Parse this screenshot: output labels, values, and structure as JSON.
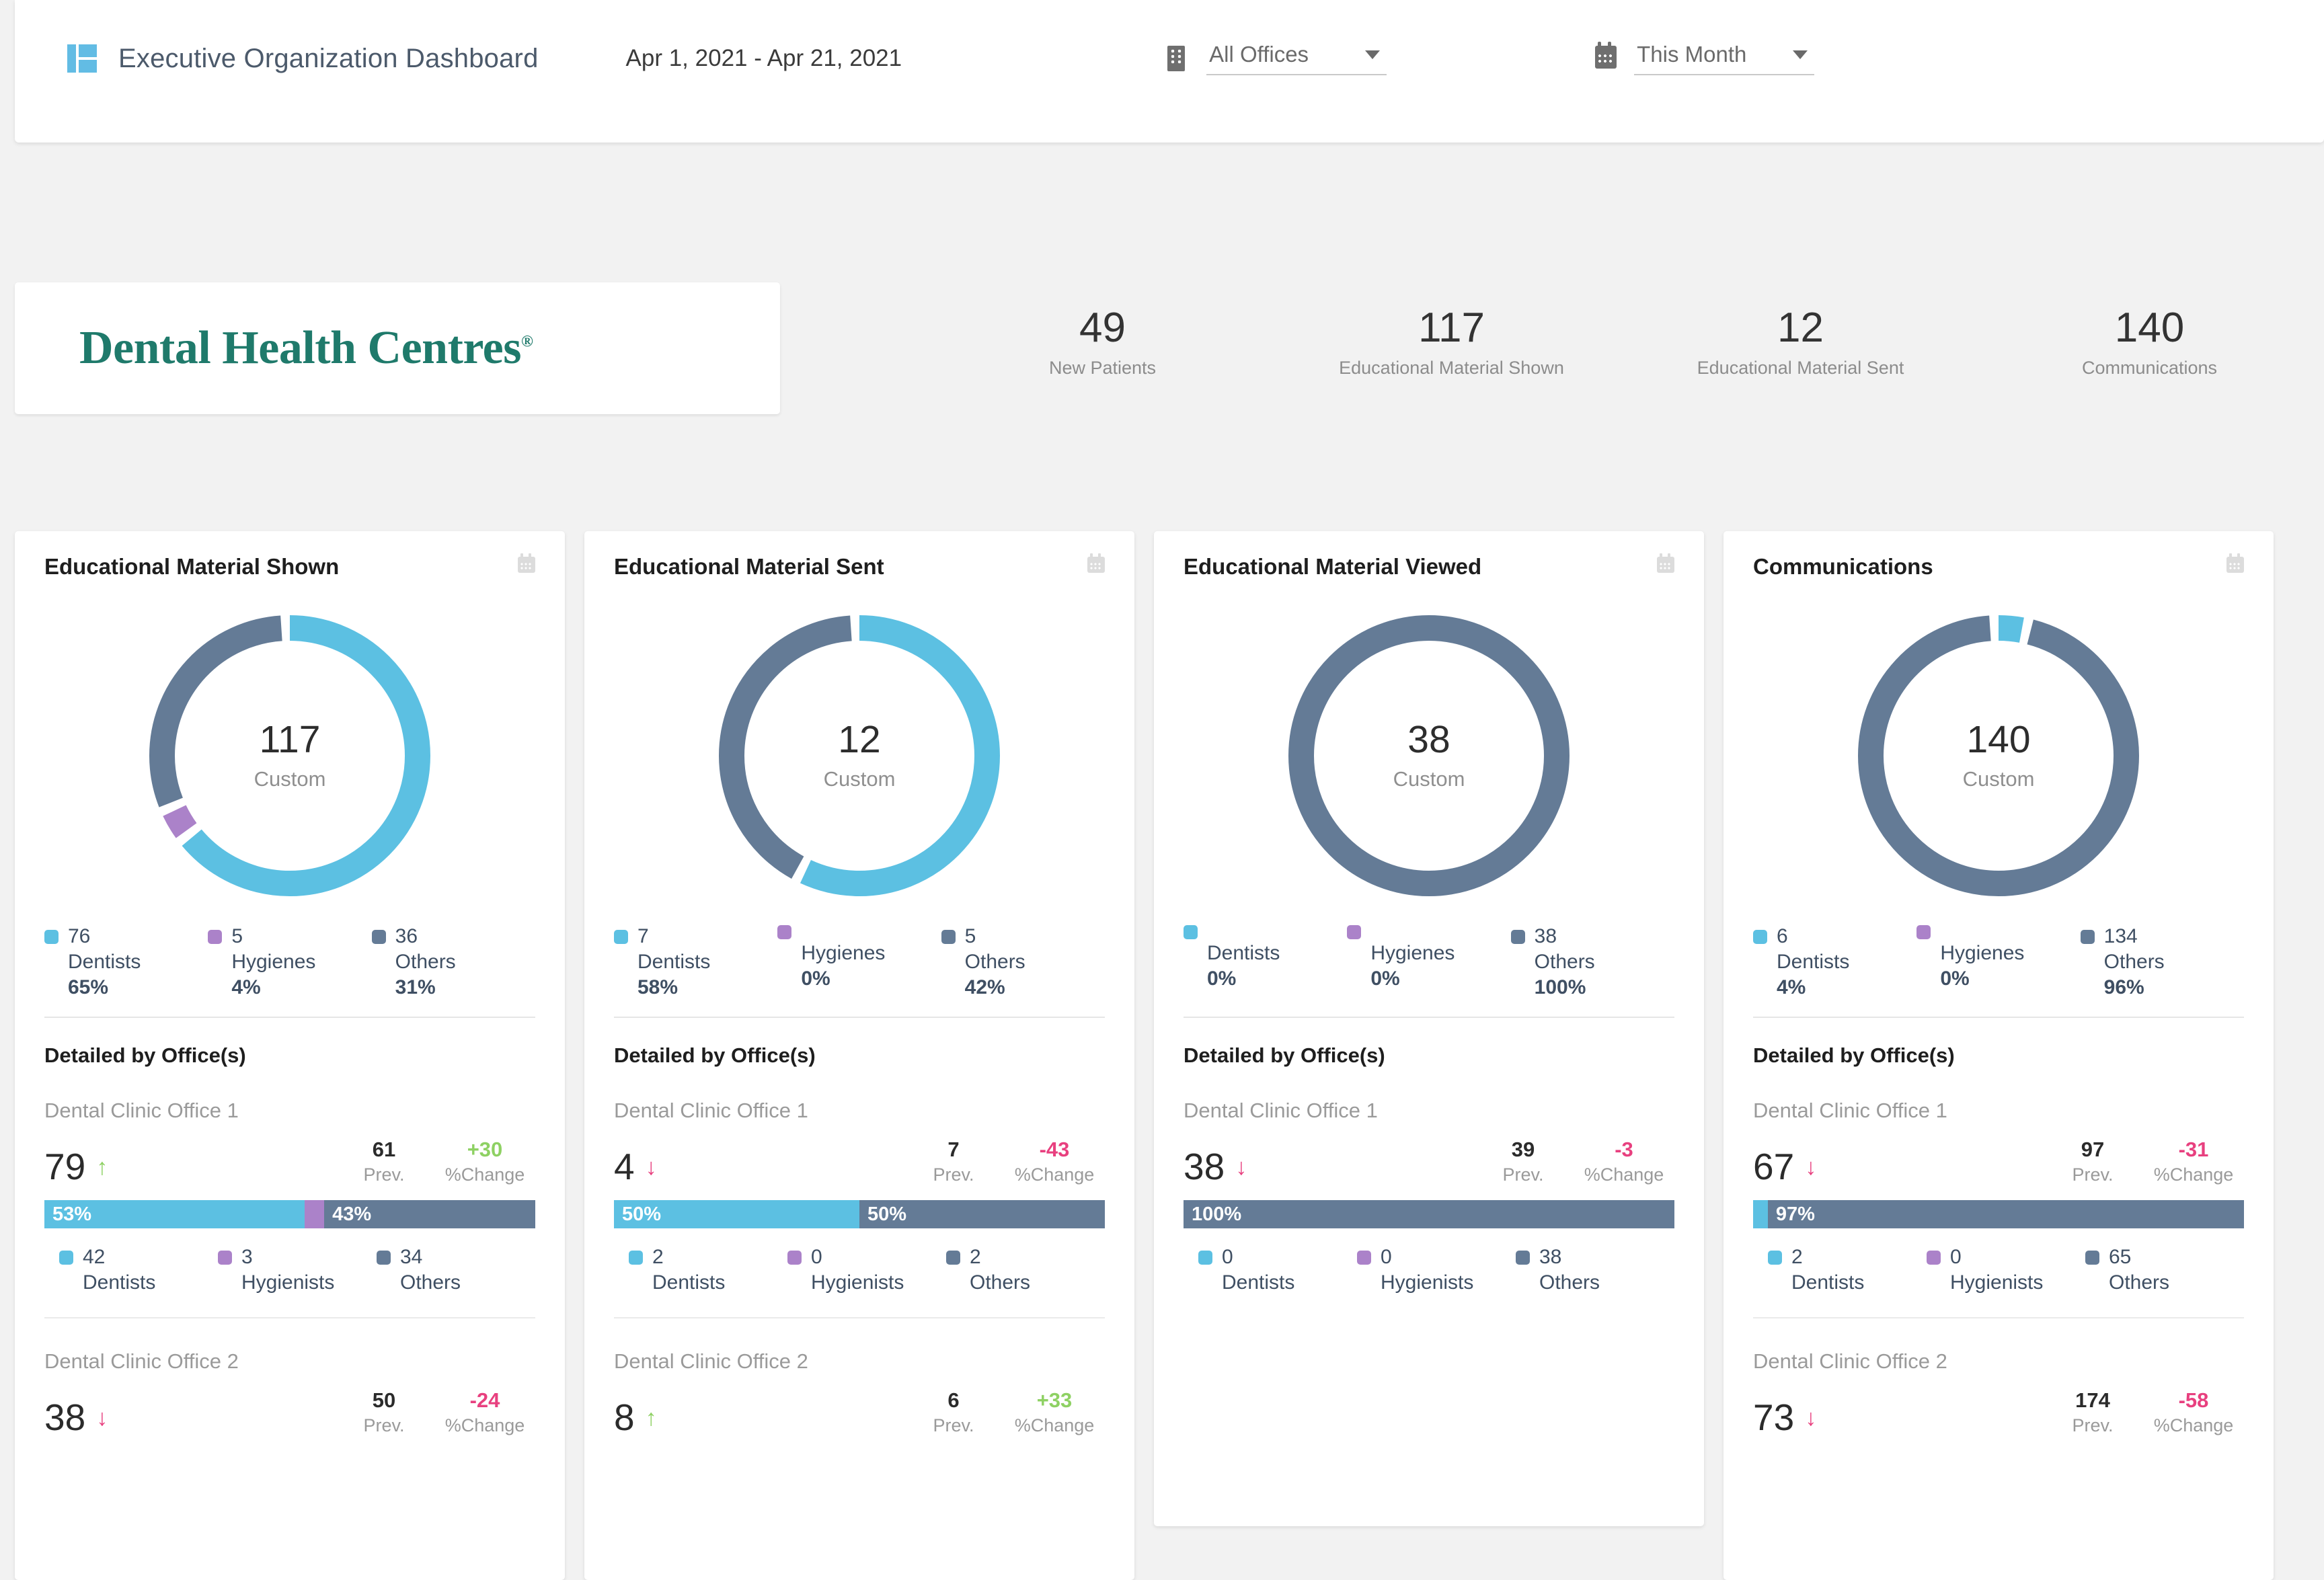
{
  "header": {
    "app_icon": "dashboard-grid-icon",
    "title": "Executive Organization Dashboard",
    "date_range": "Apr 1, 2021 - Apr 21, 2021",
    "office_filter": {
      "icon": "building-icon",
      "value": "All Offices"
    },
    "period_filter": {
      "icon": "calendar-icon",
      "value": "This Month"
    }
  },
  "brand": {
    "name": "Dental Health Centres",
    "trademark": "®",
    "color": "#1f7a6b"
  },
  "kpis": [
    {
      "value": "49",
      "label": "New Patients"
    },
    {
      "value": "117",
      "label": "Educational Material Shown"
    },
    {
      "value": "12",
      "label": "Educational Material Sent"
    },
    {
      "value": "140",
      "label": "Communications"
    }
  ],
  "colors": {
    "dentists": "#5cc0e2",
    "hygienes": "#ab82c9",
    "others": "#647b96",
    "positive": "#8ed163",
    "negative": "#e8407f"
  },
  "labels": {
    "detailed_by_office": "Detailed by Office(s)",
    "prev": "Prev.",
    "pct_change": "%Change",
    "center_sub": "Custom",
    "calendar_icon": "calendar-icon"
  },
  "cards": [
    {
      "title": "Educational Material Shown",
      "total": "117",
      "center_sub": "Custom",
      "donut": [
        {
          "name": "Dentists",
          "value": 76,
          "pct": 65,
          "color": "#5cc0e2"
        },
        {
          "name": "Hygienes",
          "value": 5,
          "pct": 4,
          "color": "#ab82c9"
        },
        {
          "name": "Others",
          "value": 36,
          "pct": 31,
          "color": "#647b96"
        }
      ],
      "legend": [
        {
          "num": "76",
          "name": "Dentists",
          "pct": "65%",
          "sw": "blue"
        },
        {
          "num": "5",
          "name": "Hygienes",
          "pct": "4%",
          "sw": "purple"
        },
        {
          "num": "36",
          "name": "Others",
          "pct": "31%",
          "sw": "slate"
        }
      ],
      "offices": [
        {
          "name": "Dental Clinic Office 1",
          "value": "79",
          "direction": "up",
          "prev": "61",
          "change": "+30",
          "change_sign": "pos",
          "bar": [
            {
              "pct": 53,
              "label": "53%",
              "sw": "blue"
            },
            {
              "pct": 4,
              "label": "",
              "sw": "purple"
            },
            {
              "pct": 43,
              "label": "43%",
              "sw": "slate"
            }
          ],
          "sub": [
            {
              "num": "42",
              "name": "Dentists",
              "sw": "blue"
            },
            {
              "num": "3",
              "name": "Hygienists",
              "sw": "purple"
            },
            {
              "num": "34",
              "name": "Others",
              "sw": "slate"
            }
          ]
        },
        {
          "name": "Dental Clinic Office 2",
          "value": "38",
          "direction": "down",
          "prev": "50",
          "change": "-24",
          "change_sign": "neg",
          "bar": [],
          "sub": []
        }
      ]
    },
    {
      "title": "Educational Material Sent",
      "total": "12",
      "center_sub": "Custom",
      "donut": [
        {
          "name": "Dentists",
          "value": 7,
          "pct": 58,
          "color": "#5cc0e2"
        },
        {
          "name": "Hygienes",
          "value": 0,
          "pct": 0,
          "color": "#ab82c9"
        },
        {
          "name": "Others",
          "value": 5,
          "pct": 42,
          "color": "#647b96"
        }
      ],
      "legend": [
        {
          "num": "7",
          "name": "Dentists",
          "pct": "58%",
          "sw": "blue"
        },
        {
          "num": "",
          "name": "Hygienes",
          "pct": "0%",
          "sw": "purple"
        },
        {
          "num": "5",
          "name": "Others",
          "pct": "42%",
          "sw": "slate"
        }
      ],
      "offices": [
        {
          "name": "Dental Clinic Office 1",
          "value": "4",
          "direction": "down",
          "prev": "7",
          "change": "-43",
          "change_sign": "neg",
          "bar": [
            {
              "pct": 50,
              "label": "50%",
              "sw": "blue"
            },
            {
              "pct": 50,
              "label": "50%",
              "sw": "slate"
            }
          ],
          "sub": [
            {
              "num": "2",
              "name": "Dentists",
              "sw": "blue"
            },
            {
              "num": "0",
              "name": "Hygienists",
              "sw": "purple"
            },
            {
              "num": "2",
              "name": "Others",
              "sw": "slate"
            }
          ]
        },
        {
          "name": "Dental Clinic Office 2",
          "value": "8",
          "direction": "up",
          "prev": "6",
          "change": "+33",
          "change_sign": "pos",
          "bar": [],
          "sub": []
        }
      ]
    },
    {
      "title": "Educational Material Viewed",
      "total": "38",
      "center_sub": "Custom",
      "donut": [
        {
          "name": "Others",
          "value": 38,
          "pct": 100,
          "color": "#647b96"
        }
      ],
      "legend": [
        {
          "num": "",
          "name": "Dentists",
          "pct": "0%",
          "sw": "blue"
        },
        {
          "num": "",
          "name": "Hygienes",
          "pct": "0%",
          "sw": "purple"
        },
        {
          "num": "38",
          "name": "Others",
          "pct": "100%",
          "sw": "slate"
        }
      ],
      "offices": [
        {
          "name": "Dental Clinic Office 1",
          "value": "38",
          "direction": "down",
          "prev": "39",
          "change": "-3",
          "change_sign": "neg",
          "bar": [
            {
              "pct": 100,
              "label": "100%",
              "sw": "slate"
            }
          ],
          "sub": [
            {
              "num": "0",
              "name": "Dentists",
              "sw": "blue"
            },
            {
              "num": "0",
              "name": "Hygienists",
              "sw": "purple"
            },
            {
              "num": "38",
              "name": "Others",
              "sw": "slate"
            }
          ]
        }
      ]
    },
    {
      "title": "Communications",
      "total": "140",
      "center_sub": "Custom",
      "donut": [
        {
          "name": "Dentists",
          "value": 6,
          "pct": 4,
          "color": "#5cc0e2"
        },
        {
          "name": "Hygienes",
          "value": 0,
          "pct": 0,
          "color": "#ab82c9"
        },
        {
          "name": "Others",
          "value": 134,
          "pct": 96,
          "color": "#647b96"
        }
      ],
      "legend": [
        {
          "num": "6",
          "name": "Dentists",
          "pct": "4%",
          "sw": "blue"
        },
        {
          "num": "",
          "name": "Hygienes",
          "pct": "0%",
          "sw": "purple"
        },
        {
          "num": "134",
          "name": "Others",
          "pct": "96%",
          "sw": "slate"
        }
      ],
      "offices": [
        {
          "name": "Dental Clinic Office 1",
          "value": "67",
          "direction": "down",
          "prev": "97",
          "change": "-31",
          "change_sign": "neg",
          "bar": [
            {
              "pct": 3,
              "label": "",
              "sw": "blue"
            },
            {
              "pct": 97,
              "label": "97%",
              "sw": "slate"
            }
          ],
          "sub": [
            {
              "num": "2",
              "name": "Dentists",
              "sw": "blue"
            },
            {
              "num": "0",
              "name": "Hygienists",
              "sw": "purple"
            },
            {
              "num": "65",
              "name": "Others",
              "sw": "slate"
            }
          ]
        },
        {
          "name": "Dental Clinic Office 2",
          "value": "73",
          "direction": "down",
          "prev": "174",
          "change": "-58",
          "change_sign": "neg",
          "bar": [],
          "sub": []
        }
      ]
    }
  ],
  "chart_data": [
    {
      "type": "pie",
      "title": "Educational Material Shown",
      "categories": [
        "Dentists",
        "Hygienes",
        "Others"
      ],
      "values": [
        76,
        5,
        36
      ],
      "percentages": [
        65,
        4,
        31
      ],
      "total": 117,
      "center_label": "Custom",
      "legend_position": "bottom"
    },
    {
      "type": "pie",
      "title": "Educational Material Sent",
      "categories": [
        "Dentists",
        "Hygienes",
        "Others"
      ],
      "values": [
        7,
        0,
        5
      ],
      "percentages": [
        58,
        0,
        42
      ],
      "total": 12,
      "center_label": "Custom",
      "legend_position": "bottom"
    },
    {
      "type": "pie",
      "title": "Educational Material Viewed",
      "categories": [
        "Dentists",
        "Hygienes",
        "Others"
      ],
      "values": [
        0,
        0,
        38
      ],
      "percentages": [
        0,
        0,
        100
      ],
      "total": 38,
      "center_label": "Custom",
      "legend_position": "bottom"
    },
    {
      "type": "pie",
      "title": "Communications",
      "categories": [
        "Dentists",
        "Hygienes",
        "Others"
      ],
      "values": [
        6,
        0,
        134
      ],
      "percentages": [
        4,
        0,
        96
      ],
      "total": 140,
      "center_label": "Custom",
      "legend_position": "bottom"
    },
    {
      "type": "bar",
      "title": "Educational Material Shown - Detailed by Office(s)",
      "categories": [
        "Dental Clinic Office 1",
        "Dental Clinic Office 2"
      ],
      "values": [
        79,
        38
      ],
      "series": [
        {
          "name": "Dentists",
          "values": [
            42,
            null
          ]
        },
        {
          "name": "Hygienists",
          "values": [
            3,
            null
          ]
        },
        {
          "name": "Others",
          "values": [
            34,
            null
          ]
        }
      ],
      "previous": [
        61,
        50
      ],
      "pct_change": [
        30,
        -24
      ]
    },
    {
      "type": "bar",
      "title": "Educational Material Sent - Detailed by Office(s)",
      "categories": [
        "Dental Clinic Office 1",
        "Dental Clinic Office 2"
      ],
      "values": [
        4,
        8
      ],
      "series": [
        {
          "name": "Dentists",
          "values": [
            2,
            null
          ]
        },
        {
          "name": "Hygienists",
          "values": [
            0,
            null
          ]
        },
        {
          "name": "Others",
          "values": [
            2,
            null
          ]
        }
      ],
      "previous": [
        7,
        6
      ],
      "pct_change": [
        -43,
        33
      ]
    },
    {
      "type": "bar",
      "title": "Educational Material Viewed - Detailed by Office(s)",
      "categories": [
        "Dental Clinic Office 1"
      ],
      "values": [
        38
      ],
      "series": [
        {
          "name": "Dentists",
          "values": [
            0
          ]
        },
        {
          "name": "Hygienists",
          "values": [
            0
          ]
        },
        {
          "name": "Others",
          "values": [
            38
          ]
        }
      ],
      "previous": [
        39
      ],
      "pct_change": [
        -3
      ]
    },
    {
      "type": "bar",
      "title": "Communications - Detailed by Office(s)",
      "categories": [
        "Dental Clinic Office 1",
        "Dental Clinic Office 2"
      ],
      "values": [
        67,
        73
      ],
      "series": [
        {
          "name": "Dentists",
          "values": [
            2,
            null
          ]
        },
        {
          "name": "Hygienists",
          "values": [
            0,
            null
          ]
        },
        {
          "name": "Others",
          "values": [
            65,
            null
          ]
        }
      ],
      "previous": [
        97,
        174
      ],
      "pct_change": [
        -31,
        -58
      ]
    }
  ]
}
